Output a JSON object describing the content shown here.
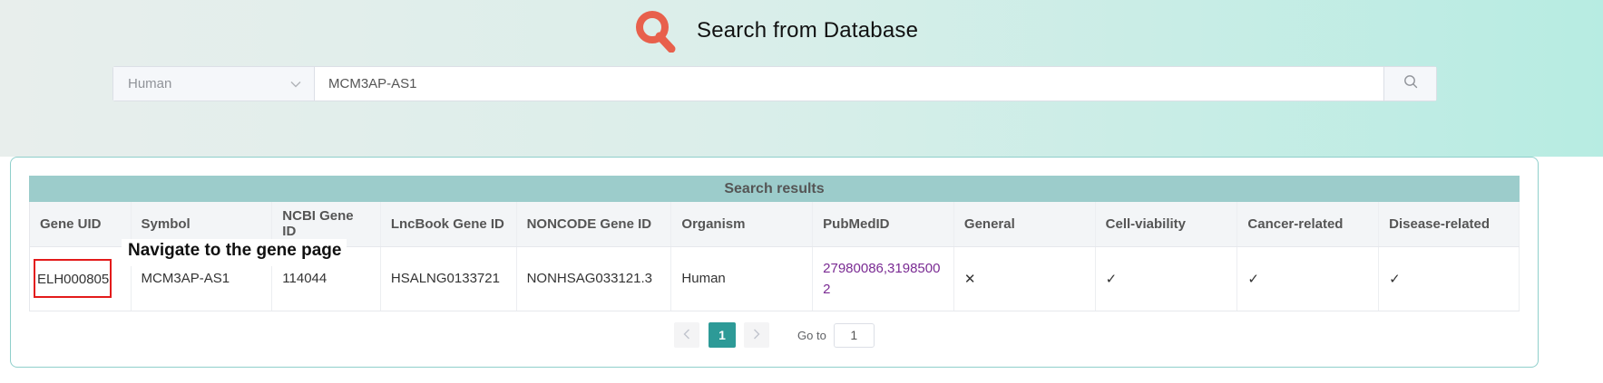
{
  "header": {
    "title": "Search from Database"
  },
  "search": {
    "organism": "Human",
    "query": "MCM3AP-AS1"
  },
  "results": {
    "title": "Search results",
    "columns": [
      "Gene UID",
      "Symbol",
      "NCBI Gene ID",
      "LncBook Gene ID",
      "NONCODE Gene ID",
      "Organism",
      "PubMedID",
      "General",
      "Cell-viability",
      "Cancer-related",
      "Disease-related"
    ],
    "rows": [
      {
        "gene_uid": "ELH000805",
        "symbol": "MCM3AP-AS1",
        "ncbi_gene_id": "114044",
        "lncbook_gene_id": "HSALNG0133721",
        "noncode_gene_id": "NONHSAG033121.3",
        "organism": "Human",
        "pubmed_line1": "27980086,3198500",
        "pubmed_line2": "2",
        "general": "✕",
        "cell_viability": "✓",
        "cancer_related": "✓",
        "disease_related": "✓"
      }
    ]
  },
  "annotation": {
    "text": "Navigate to the gene page"
  },
  "pagination": {
    "current_page": "1",
    "goto_label": "Go to",
    "goto_value": "1"
  },
  "colors": {
    "accent": "#2d9a97",
    "results_header": "#9ccccb",
    "link": "#7a2b93",
    "highlight_box": "#e31b1b",
    "logo": "#e8604c"
  }
}
